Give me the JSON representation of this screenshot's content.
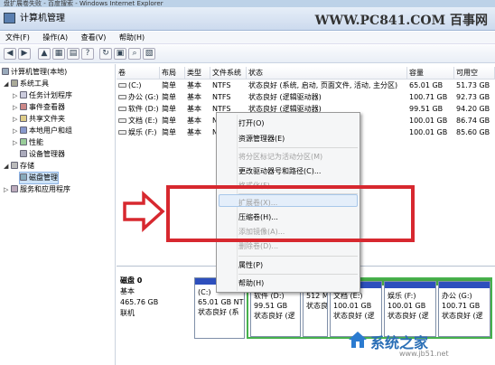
{
  "ie_bar": {
    "text": "盘扩展卷失败 - 百度搜索 - Windows Internet Explorer"
  },
  "window": {
    "title": "计算机管理"
  },
  "watermark": {
    "top_right": "WWW.PC841.COM 百事网",
    "bottom_right": "系统之家",
    "bottom_url": "www.jb51.net"
  },
  "menu": [
    "文件(F)",
    "操作(A)",
    "查看(V)",
    "帮助(H)"
  ],
  "toolbar_icons": [
    "back-icon",
    "forward-icon",
    "up-folder-icon",
    "console-tree-icon",
    "properties-icon",
    "help-icon",
    "refresh-icon",
    "export-list-icon",
    "search-icon",
    "settings-icon"
  ],
  "tree": [
    {
      "label": "计算机管理(本地)",
      "level": 0,
      "expander": "",
      "icon": "computer-icon"
    },
    {
      "label": "系统工具",
      "level": 1,
      "expander": "◢",
      "icon": "tools-icon"
    },
    {
      "label": "任务计划程序",
      "level": 2,
      "expander": "▷",
      "icon": "task-scheduler-icon"
    },
    {
      "label": "事件查看器",
      "level": 2,
      "expander": "▷",
      "icon": "event-viewer-icon"
    },
    {
      "label": "共享文件夹",
      "level": 2,
      "expander": "▷",
      "icon": "shared-folder-icon"
    },
    {
      "label": "本地用户和组",
      "level": 2,
      "expander": "▷",
      "icon": "users-icon"
    },
    {
      "label": "性能",
      "level": 2,
      "expander": "▷",
      "icon": "performance-icon"
    },
    {
      "label": "设备管理器",
      "level": 2,
      "expander": "",
      "icon": "device-manager-icon"
    },
    {
      "label": "存储",
      "level": 1,
      "expander": "◢",
      "icon": "storage-icon"
    },
    {
      "label": "磁盘管理",
      "level": 2,
      "expander": "",
      "icon": "disk-management-icon",
      "selected": true
    },
    {
      "label": "服务和应用程序",
      "level": 1,
      "expander": "▷",
      "icon": "services-icon"
    }
  ],
  "columns": [
    "卷",
    "布局",
    "类型",
    "文件系统",
    "状态",
    "容量",
    "可用空"
  ],
  "volumes": [
    {
      "name": "(C:)",
      "layout": "简单",
      "type": "基本",
      "fs": "NTFS",
      "status": "状态良好 (系统, 启动, 页面文件, 活动, 主分区)",
      "capacity": "65.01 GB",
      "free": "51.73 GB"
    },
    {
      "name": "办公 (G:)",
      "layout": "简单",
      "type": "基本",
      "fs": "NTFS",
      "status": "状态良好 (逻辑驱动器)",
      "capacity": "100.71 GB",
      "free": "92.73 GB"
    },
    {
      "name": "软件 (D:)",
      "layout": "简单",
      "type": "基本",
      "fs": "NTFS",
      "status": "状态良好 (逻辑驱动器)",
      "capacity": "99.51 GB",
      "free": "94.20 GB"
    },
    {
      "name": "文档 (E:)",
      "layout": "简单",
      "type": "基本",
      "fs": "N",
      "status": "",
      "capacity": "100.01 GB",
      "free": "86.74 GB"
    },
    {
      "name": "娱乐 (F:)",
      "layout": "简单",
      "type": "基本",
      "fs": "N",
      "status": "",
      "capacity": "100.01 GB",
      "free": "85.60 GB"
    }
  ],
  "context_menu": [
    {
      "label": "打开(O)",
      "disabled": false
    },
    {
      "label": "资源管理器(E)",
      "disabled": false
    },
    {
      "sep": true
    },
    {
      "label": "将分区标记为活动分区(M)",
      "disabled": true
    },
    {
      "label": "更改驱动器号和路径(C)...",
      "disabled": false
    },
    {
      "label": "格式化(F)...",
      "disabled": true
    },
    {
      "sep": true
    },
    {
      "label": "扩展卷(X)...",
      "disabled": true
    },
    {
      "label": "压缩卷(H)...",
      "disabled": false
    },
    {
      "label": "添加镜像(A)...",
      "disabled": true
    },
    {
      "label": "删除卷(D)...",
      "disabled": true
    },
    {
      "sep": true
    },
    {
      "label": "属性(P)",
      "disabled": false
    },
    {
      "sep": true
    },
    {
      "label": "帮助(H)",
      "disabled": false
    }
  ],
  "disk": {
    "name": "磁盘 0",
    "type": "基本",
    "size": "465.76 GB",
    "state": "联机"
  },
  "partitions": [
    {
      "label": "(C:)",
      "size": "65.01 GB NT",
      "status": "状态良好 (系",
      "kind": "primary"
    },
    {
      "label": "软件 (D:)",
      "size": "99.51 GB",
      "status": "状态良好 (逻",
      "kind": "logical"
    },
    {
      "label": "",
      "size": "512 M",
      "status": "状态良",
      "kind": "logical"
    },
    {
      "label": "文档 (E:)",
      "size": "100.01 GB",
      "status": "状态良好 (逻",
      "kind": "logical"
    },
    {
      "label": "娱乐 (F:)",
      "size": "100.01 GB",
      "status": "状态良好 (逻",
      "kind": "logical"
    },
    {
      "label": "办公 (G:)",
      "size": "100.71 GB",
      "status": "状态良好 (逻",
      "kind": "logical"
    }
  ],
  "colors": {
    "primary_band": "#2d4fbd",
    "extended_border": "#46b14c",
    "highlight_box": "#d7282f"
  }
}
